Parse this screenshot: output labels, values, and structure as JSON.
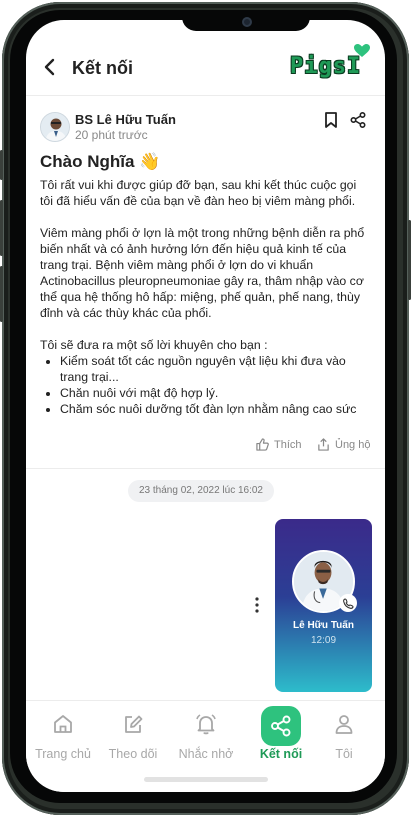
{
  "header": {
    "title": "Kết nối",
    "logo_text": "PigsI",
    "brand_color": "#1f9a57"
  },
  "post": {
    "author": "BS Lê Hữu Tuấn",
    "time": "20 phút trước",
    "greeting": "Chào Nghĩa 👋",
    "paragraph1": "Tôi rất vui khi được giúp đỡ bạn, sau khi kết thúc cuộc gọi tôi đã hiểu vấn đề của bạn về đàn heo bị viêm màng phổi.",
    "paragraph2": "Viêm màng phổi ở lợn là một trong những bệnh diễn ra phổ biến nhất và có ảnh hưởng lớn đến hiệu quả kinh tế của trang trại. Bệnh viêm màng phổi ở lợn do vi khuẩn Actinobacillus pleuropneumoniae gây ra, thâm nhập vào cơ thể qua hệ thống hô hấp: miệng, phế quản, phế nang, thùy đỉnh và các thùy khác của phổi.",
    "paragraph3": "Tôi sẽ đưa ra một số lời khuyên cho bạn :",
    "tips": [
      "Kiểm soát tốt các nguồn nguyên vật liệu khi đưa vào trang trại...",
      "Chăn nuôi với mật độ hợp lý.",
      "Chăm sóc nuôi dưỡng tốt đàn lợn nhằm nâng cao sức"
    ],
    "like_label": "Thích",
    "support_label": "Ủng hộ"
  },
  "chat": {
    "date": "23 tháng 02, 2022 lúc 16:02",
    "call_name": "Lê Hữu Tuấn",
    "call_time": "12:09"
  },
  "nav": {
    "items": [
      {
        "label": "Trang chủ",
        "icon": "home-icon"
      },
      {
        "label": "Theo dõi",
        "icon": "edit-icon"
      },
      {
        "label": "Nhắc nhở",
        "icon": "bell-icon"
      },
      {
        "label": "Kết nối",
        "icon": "share-nodes-icon",
        "active": true
      },
      {
        "label": "Tôi",
        "icon": "user-icon"
      }
    ],
    "active_color": "#2ec27e"
  }
}
